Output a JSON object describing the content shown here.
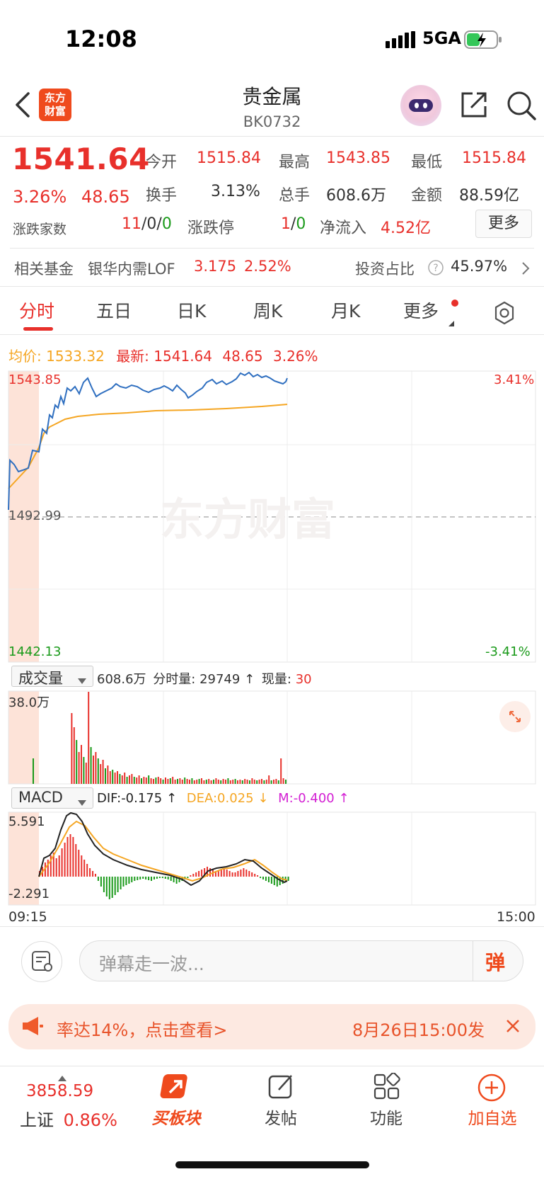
{
  "status_bar": {
    "time": "12:08",
    "network": "5GA"
  },
  "header": {
    "logo_line1": "东方",
    "logo_line2": "财富",
    "title": "贵金属",
    "code": "BK0732"
  },
  "quote": {
    "price": "1541.64",
    "change_pct": "3.26%",
    "change": "48.65",
    "open_label": "今开",
    "open": "1515.84",
    "high_label": "最高",
    "high": "1543.85",
    "low_label": "最低",
    "low": "1515.84",
    "turnover_label": "换手",
    "turnover": "3.13%",
    "volume_label": "总手",
    "volume": "608.6万",
    "amount_label": "金额",
    "amount": "88.59亿",
    "breadth_label": "涨跌家数",
    "breadth_up": "11",
    "breadth_sep1": "/",
    "breadth_flat": "0",
    "breadth_sep2": "/",
    "breadth_down": "0",
    "limit_label": "涨跌停",
    "limit_up": "1",
    "limit_sep": "/",
    "limit_down": "0",
    "inflow_label": "净流入",
    "inflow": "4.52亿",
    "more": "更多"
  },
  "fund": {
    "label": "相关基金",
    "name": "银华内需LOF",
    "price": "3.175",
    "pct": "2.52%",
    "ratio_label": "投资占比",
    "ratio": "45.97%"
  },
  "tabs": [
    "分时",
    "五日",
    "日K",
    "周K",
    "月K",
    "更多"
  ],
  "intraday": {
    "avg_label": "均价:",
    "avg": "1533.32",
    "latest_label": "最新:",
    "latest": "1541.64",
    "latest_change": "48.65",
    "latest_pct": "3.26%",
    "y_top": "1543.85",
    "y_mid": "1492.99",
    "y_bottom": "1442.13",
    "pct_top": "3.41%",
    "pct_bottom": "-3.41%",
    "watermark": "东方财富"
  },
  "volume": {
    "selector": "成交量",
    "total": "608.6万",
    "minute_label": "分时量:",
    "minute": "29749",
    "now_label": "现量:",
    "now": "30",
    "y_max": "38.0万"
  },
  "macd": {
    "selector": "MACD",
    "dif": "DIF:-0.175",
    "dea": "DEA:0.025",
    "m": "M:-0.400",
    "y_top": "5.591",
    "y_bottom": "-2.291"
  },
  "time_axis": {
    "start": "09:15",
    "end": "15:00"
  },
  "danmaku": {
    "placeholder": "弹幕走一波...",
    "button": "弹"
  },
  "banner": {
    "left_text": "率达14%，点击查看>",
    "right_text": "8月26日15:00发"
  },
  "bottom_nav": {
    "index_value": "3858.59",
    "index_name": "上证",
    "index_pct": "0.86%",
    "items": [
      "买板块",
      "发帖",
      "功能",
      "加自选"
    ]
  },
  "colors": {
    "up": "#e8302b",
    "down": "#1a9a1a",
    "price_line": "#2f6fc0",
    "avg_line": "#f5a623",
    "brand": "#ef4a1d"
  }
}
